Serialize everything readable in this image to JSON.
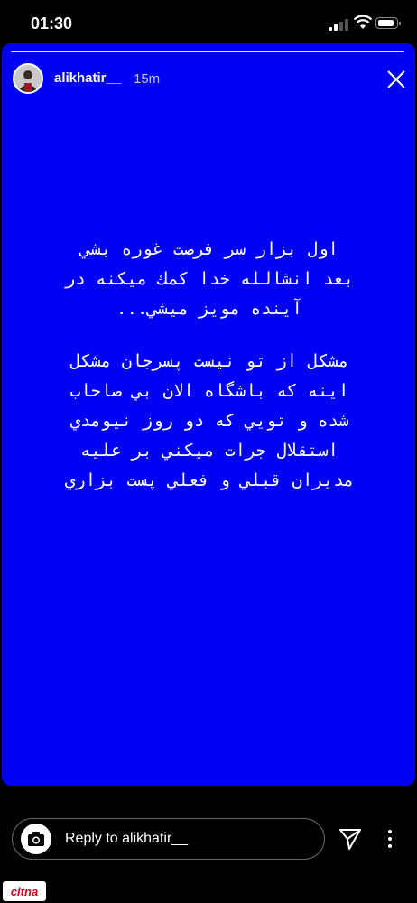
{
  "status_bar": {
    "time": "01:30"
  },
  "story": {
    "username": "alikhatir__",
    "time_ago": "15m",
    "background_color": "#0000f2",
    "paragraph1": [
      "اول بزار سر فرصت غوره بشي",
      "بعد انشالله خدا كمك ميكنه در",
      "آينده مويز ميشي..."
    ],
    "paragraph2": [
      "مشكل از تو نيست پسرجان مشكل",
      "اينه كه باشگاه الان بي صاحاب",
      "شده و تويي كه دو روز نيومدي",
      "استقلال جرات ميكني بر عليه",
      "مديران قبلي و فعلي پست بزاري"
    ]
  },
  "reply": {
    "placeholder": "Reply to alikhatir__"
  },
  "watermark": {
    "text": "citna"
  },
  "icons": {
    "close": "close-icon",
    "camera": "camera-icon",
    "send": "send-icon",
    "more": "more-vertical-icon"
  }
}
